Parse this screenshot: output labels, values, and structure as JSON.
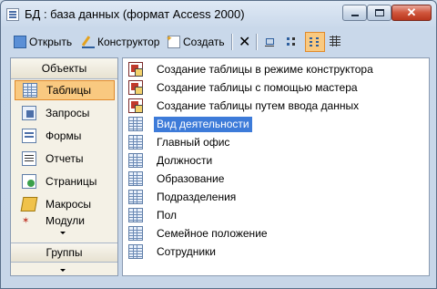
{
  "window": {
    "title": "БД : база данных (формат Access 2000)"
  },
  "toolbar": {
    "open_label": "Открыть",
    "design_label": "Конструктор",
    "create_label": "Создать",
    "delete_icon": "x-delete-icon",
    "large_icons_icon": "large-icons-icon",
    "small_icons_icon": "small-icons-icon",
    "list_view_icon": "list-view-icon",
    "details_icon": "details-view-icon"
  },
  "sidebar": {
    "header": "Объекты",
    "items": [
      {
        "label": "Таблицы",
        "icon": "table-icon",
        "selected": true
      },
      {
        "label": "Запросы",
        "icon": "query-icon"
      },
      {
        "label": "Формы",
        "icon": "form-icon"
      },
      {
        "label": "Отчеты",
        "icon": "report-icon"
      },
      {
        "label": "Страницы",
        "icon": "page-icon"
      },
      {
        "label": "Макросы",
        "icon": "macro-icon"
      },
      {
        "label": "Модули",
        "icon": "module-icon"
      }
    ],
    "groups_label": "Группы"
  },
  "list": {
    "items": [
      {
        "label": "Создание таблицы в режиме конструктора",
        "icon": "wizard-icon"
      },
      {
        "label": "Создание таблицы с помощью мастера",
        "icon": "wizard-icon"
      },
      {
        "label": "Создание таблицы путем ввода данных",
        "icon": "wizard-icon"
      },
      {
        "label": "Вид деятельности",
        "icon": "table-icon",
        "selected": true
      },
      {
        "label": "Главный офис",
        "icon": "table-icon"
      },
      {
        "label": "Должности",
        "icon": "table-icon"
      },
      {
        "label": "Образование",
        "icon": "table-icon"
      },
      {
        "label": "Подразделения",
        "icon": "table-icon"
      },
      {
        "label": "Пол",
        "icon": "table-icon"
      },
      {
        "label": "Семейное положение",
        "icon": "table-icon"
      },
      {
        "label": "Сотрудники",
        "icon": "table-icon"
      }
    ]
  },
  "colors": {
    "selection": "#3d7bd9",
    "sidebar_selected": "#f9c980",
    "close_button": "#d0563c"
  }
}
